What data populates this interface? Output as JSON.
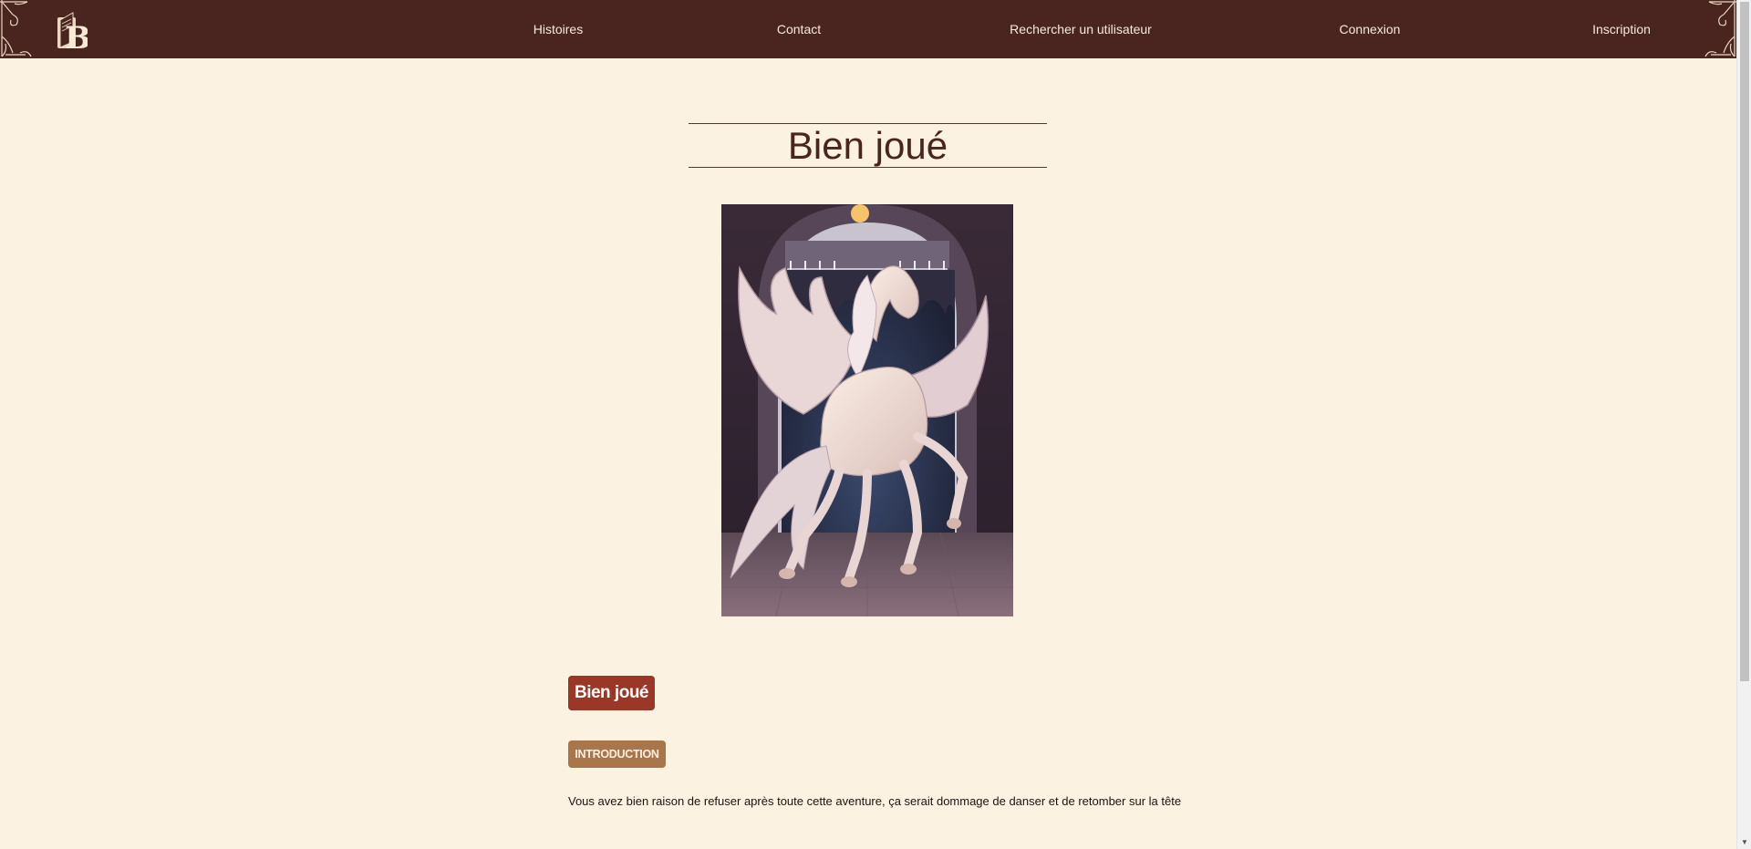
{
  "navbar": {
    "logo_icon": "book-logo-icon",
    "links": [
      "Histoires",
      "Contact",
      "Rechercher un utilisateur",
      "Connexion",
      "Inscription"
    ]
  },
  "main": {
    "title": "Bien joué",
    "illustration": "pegasus-illustration",
    "badge_title": "Bien joué",
    "section_label": "INTRODUCTION",
    "body_text": "Vous avez bien raison de refuser après toute cette aventure, ça serait dommage de danser et de retomber sur la tête"
  },
  "colors": {
    "navbar_bg": "#4a2520",
    "page_bg": "#fcf2e1",
    "title_badge": "#9a3726",
    "section_badge": "#a8764a"
  }
}
